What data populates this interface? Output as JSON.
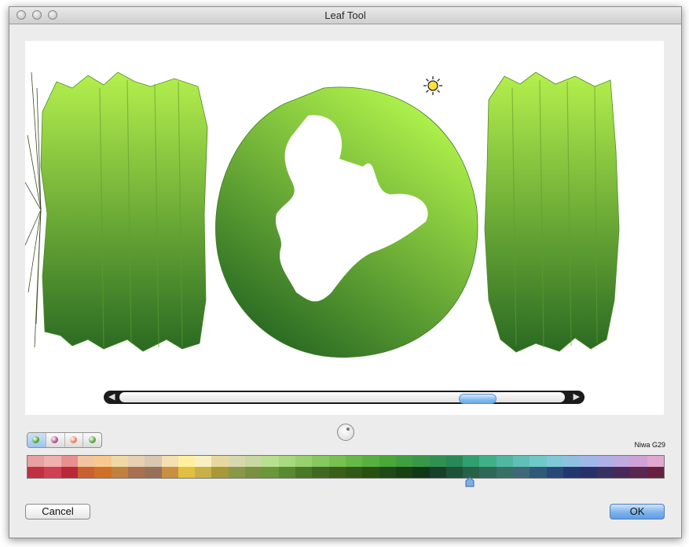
{
  "window": {
    "title": "Leaf Tool"
  },
  "titlebar": {
    "lights": [
      "close-icon",
      "minimize-icon",
      "zoom-icon"
    ]
  },
  "preview": {
    "icon": "sun-icon",
    "colors": {
      "leaf_light": "#b5f04d",
      "leaf_dark": "#2a6a22",
      "background": "#ffffff"
    },
    "scroll_position": 0.83
  },
  "color_mode": {
    "selected_index": 0,
    "ball_colors": [
      "#4aa32e",
      "#b24a8e",
      "#ef7d5d",
      "#53a43a"
    ]
  },
  "palette": {
    "name": "Niwa G29",
    "selected_index": 76
  },
  "buttons": {
    "cancel_label": "Cancel",
    "ok_label": "OK"
  }
}
